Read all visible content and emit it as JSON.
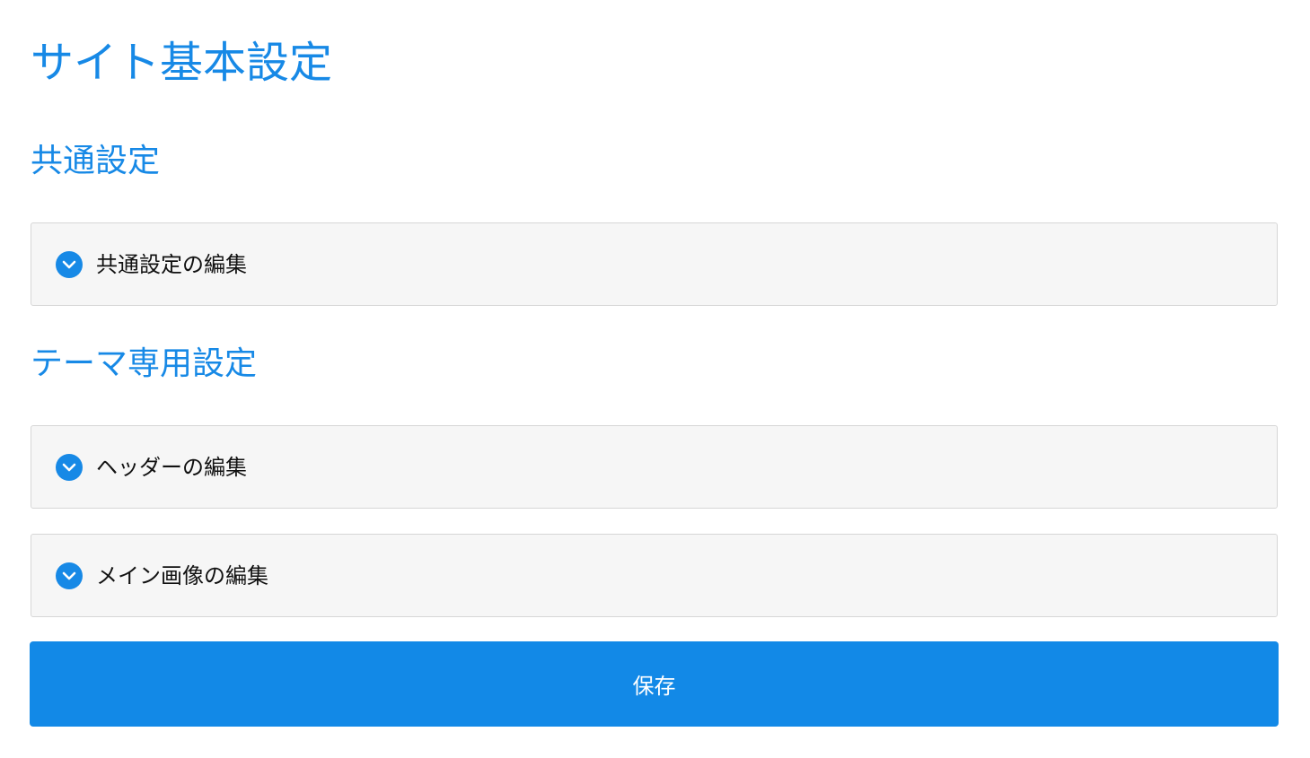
{
  "page": {
    "title": "サイト基本設定"
  },
  "sections": [
    {
      "heading": "共通設定",
      "panels": [
        {
          "label": "共通設定の編集",
          "icon": "chevron-down-icon"
        }
      ]
    },
    {
      "heading": "テーマ専用設定",
      "panels": [
        {
          "label": "ヘッダーの編集",
          "icon": "chevron-down-icon"
        },
        {
          "label": "メイン画像の編集",
          "icon": "chevron-down-icon"
        }
      ]
    }
  ],
  "actions": {
    "save_label": "保存"
  },
  "colors": {
    "accent": "#1789e6",
    "button": "#1289e7",
    "panel_bg": "#f6f6f6",
    "panel_border": "#d6d6d6"
  }
}
